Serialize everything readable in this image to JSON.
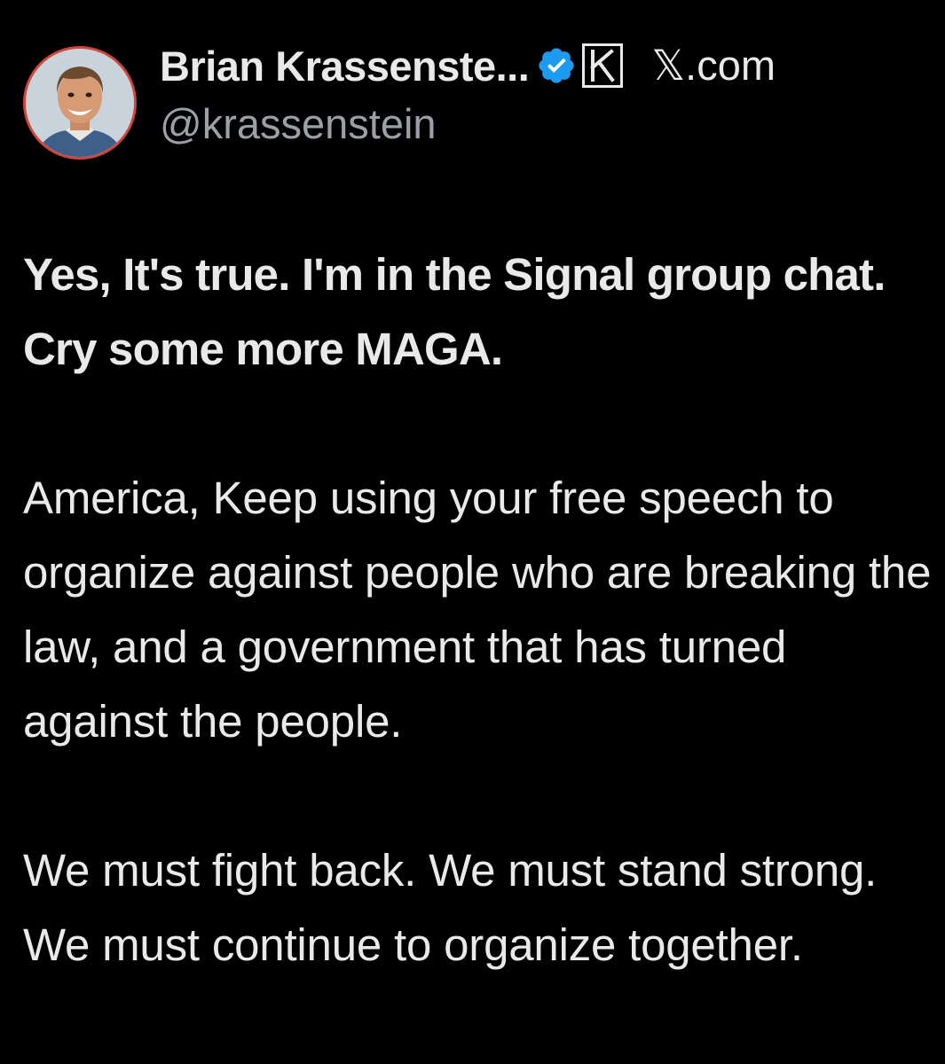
{
  "author": {
    "display_name": "Brian Krassenste...",
    "handle": "@krassenstein",
    "verified_icon": "verified-badge-icon",
    "affiliate_icon": "k-affiliate-icon",
    "site_label": "𝕏.com",
    "verified_color": "#1d9bf0",
    "avatar_ring_color": "#d0463a"
  },
  "tweet": {
    "paragraphs": [
      "Yes, It's true.  I'm in the Signal group chat.  Cry some more MAGA.",
      "America, Keep using your free speech to organize against people who are breaking the law, and a government that has turned against the people.",
      "We must fight back.  We must stand strong.  We must continue to organize together."
    ]
  },
  "theme": {
    "background": "#000000",
    "text": "#e7e9ea",
    "secondary_text": "#9aa0a6"
  }
}
